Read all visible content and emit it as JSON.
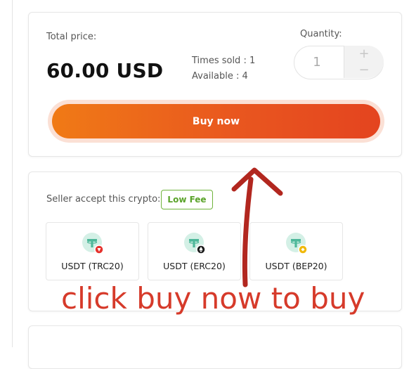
{
  "purchase": {
    "total_label": "Total price:",
    "total_price": "60.00 USD",
    "times_sold": "Times sold : 1",
    "available": "Available : 4",
    "quantity_label": "Quantity:",
    "quantity_value": "1",
    "plus_glyph": "+",
    "minus_glyph": "−",
    "buy_label": "Buy now"
  },
  "crypto": {
    "seller_label": "Seller accept this crypto:",
    "fee_badge": "Low Fee",
    "options": [
      {
        "label": "USDT (TRC20)",
        "icon": "usdt-trc20-icon",
        "badge_color": "#e5322d"
      },
      {
        "label": "USDT (ERC20)",
        "icon": "usdt-erc20-icon",
        "badge_color": "#1b1b1b"
      },
      {
        "label": "USDT (BEP20)",
        "icon": "usdt-bep20-icon",
        "badge_color": "#f0b90b"
      }
    ]
  },
  "annotation": {
    "text": "click buy now to buy",
    "color": "#d63a2a"
  },
  "colors": {
    "accent": "#ec6a1c",
    "tether": "#4fb89a",
    "low_fee": "#5aa32a"
  }
}
